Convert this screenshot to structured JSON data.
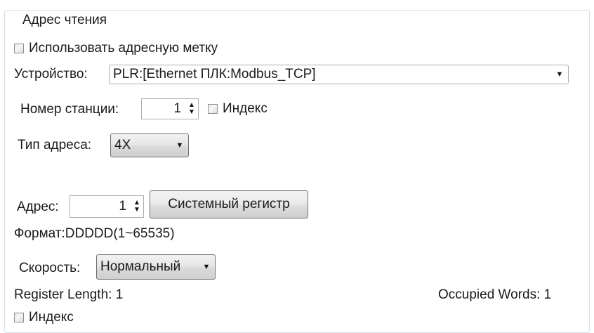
{
  "group": {
    "title": "Адрес чтения"
  },
  "use_address_tag": {
    "label": "Использовать адресную метку",
    "checked": false
  },
  "device": {
    "label": "Устройство:",
    "value": "PLR:[Ethernet ПЛК:Modbus_TCP]"
  },
  "station": {
    "label": "Номер станции:",
    "value": "1",
    "index_label": "Индекс",
    "index_checked": false
  },
  "address_type": {
    "label": "Тип адреса:",
    "value": "4X"
  },
  "address": {
    "label": "Адрес:",
    "value": "1",
    "system_register_button": "Системный регистр"
  },
  "format_text": "Формат:DDDDD(1~65535)",
  "speed": {
    "label": "Скорость:",
    "value": "Нормальный"
  },
  "register_length": "Register Length: 1",
  "occupied_words": "Occupied Words: 1",
  "bottom_index": {
    "label": "Индекс",
    "checked": false
  },
  "icons": {
    "dropdown": "chevron-down-icon",
    "spinner": "up-down-spinner-icon"
  }
}
